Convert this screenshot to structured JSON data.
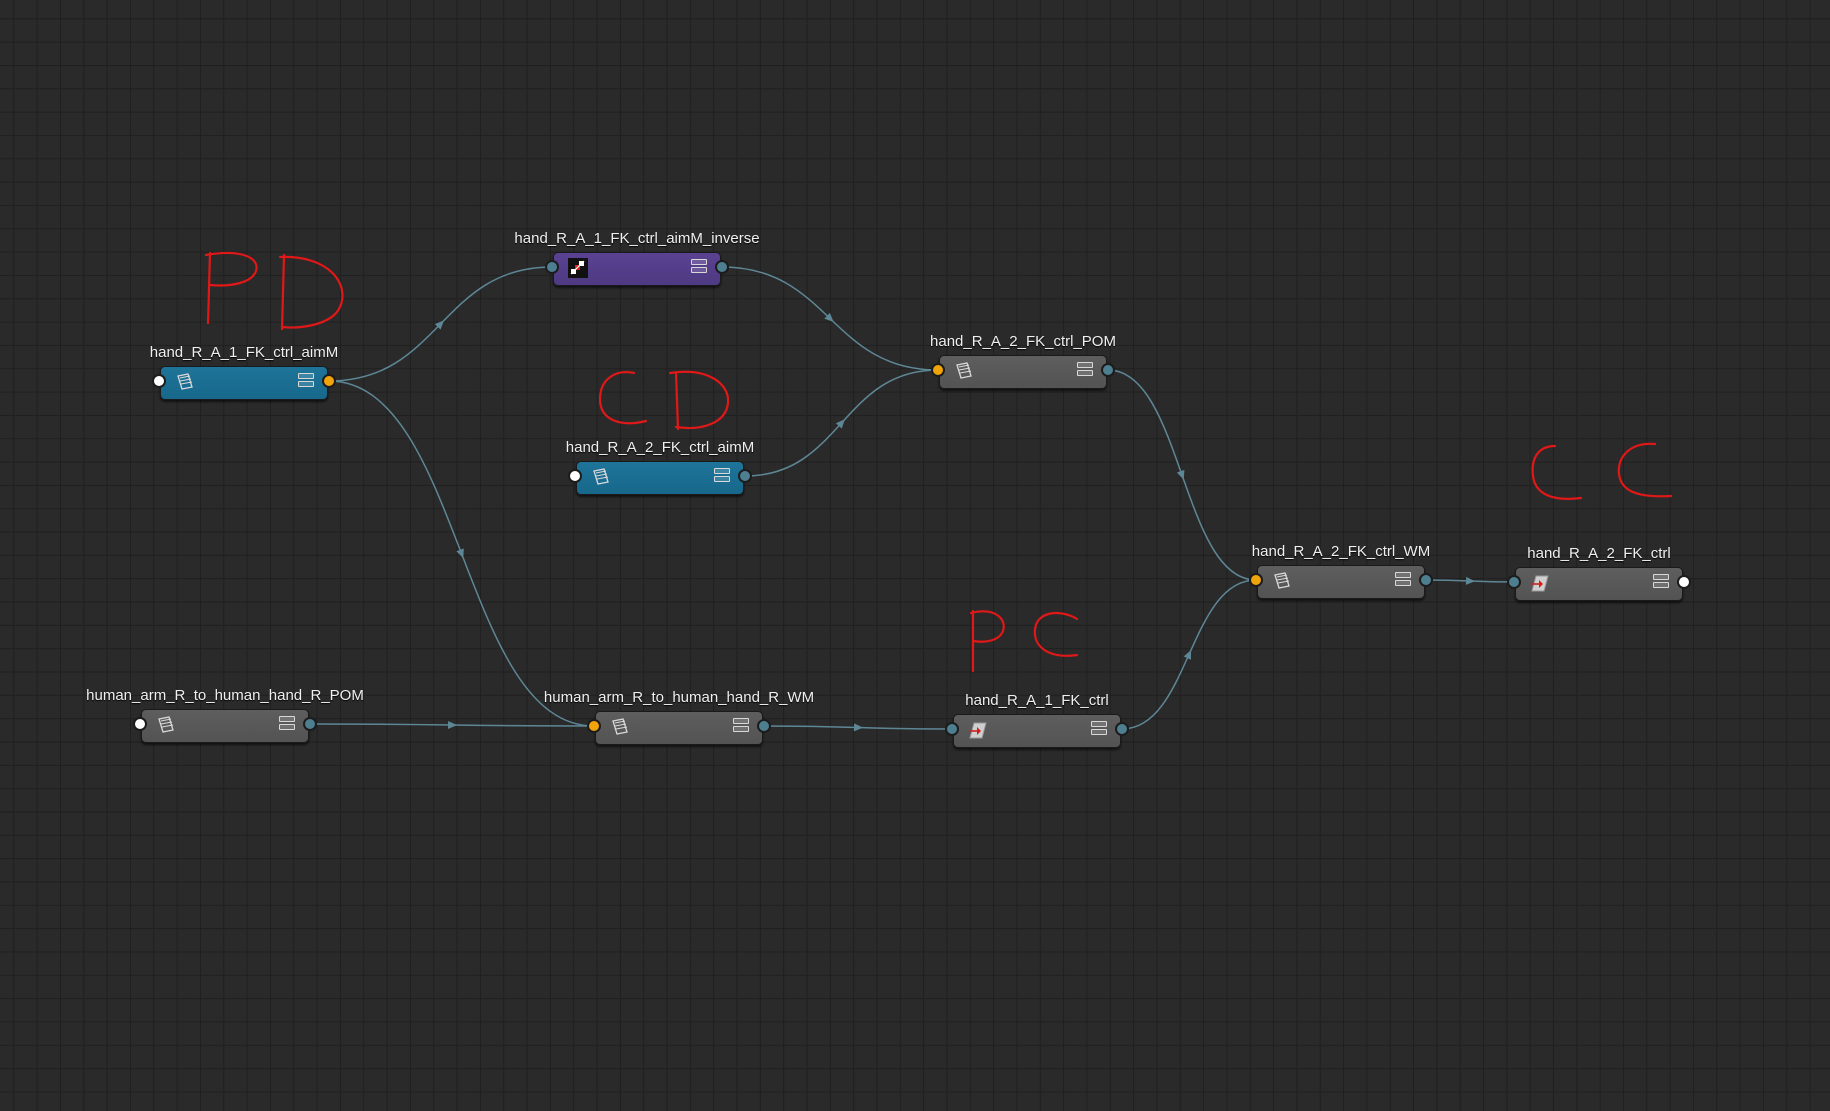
{
  "nodes": [
    {
      "key": "n_aimM1",
      "title": "hand_R_A_1_FK_ctrl_aimM",
      "color": "blue",
      "icon": "matrix-stack-icon",
      "in_port": "white",
      "out_port": "orange"
    },
    {
      "key": "n_aimM1_inv",
      "title": "hand_R_A_1_FK_ctrl_aimM_inverse",
      "color": "purple",
      "icon": "inverse-matrix-icon",
      "in_port": "teal",
      "out_port": "teal"
    },
    {
      "key": "n_aimM2",
      "title": "hand_R_A_2_FK_ctrl_aimM",
      "color": "blue",
      "icon": "matrix-stack-icon",
      "in_port": "white",
      "out_port": "teal"
    },
    {
      "key": "n_pom2",
      "title": "hand_R_A_2_FK_ctrl_POM",
      "color": "gray",
      "icon": "matrix-stack-icon",
      "in_port": "orange",
      "out_port": "teal"
    },
    {
      "key": "n_wm2",
      "title": "hand_R_A_2_FK_ctrl_WM",
      "color": "gray",
      "icon": "matrix-stack-icon",
      "in_port": "orange",
      "out_port": "teal"
    },
    {
      "key": "n_ctrl2",
      "title": "hand_R_A_2_FK_ctrl",
      "color": "gray",
      "icon": "transform-icon",
      "in_port": "teal",
      "out_port": "white"
    },
    {
      "key": "n_arm_pom",
      "title": "human_arm_R_to_human_hand_R_POM",
      "color": "gray",
      "icon": "matrix-stack-icon",
      "in_port": "white",
      "out_port": "teal"
    },
    {
      "key": "n_arm_wm",
      "title": "human_arm_R_to_human_hand_R_WM",
      "color": "gray",
      "icon": "matrix-stack-icon",
      "in_port": "orange",
      "out_port": "teal"
    },
    {
      "key": "n_ctrl1",
      "title": "hand_R_A_1_FK_ctrl",
      "color": "gray",
      "icon": "transform-icon",
      "in_port": "teal",
      "out_port": "teal"
    }
  ],
  "connections": [
    {
      "from": "n_aimM1",
      "to": "n_aimM1_inv"
    },
    {
      "from": "n_aimM1",
      "to": "n_arm_wm"
    },
    {
      "from": "n_aimM1_inv",
      "to": "n_pom2"
    },
    {
      "from": "n_aimM2",
      "to": "n_pom2"
    },
    {
      "from": "n_pom2",
      "to": "n_wm2"
    },
    {
      "from": "n_arm_pom",
      "to": "n_arm_wm"
    },
    {
      "from": "n_arm_wm",
      "to": "n_ctrl1"
    },
    {
      "from": "n_ctrl1",
      "to": "n_wm2"
    },
    {
      "from": "n_wm2",
      "to": "n_ctrl2"
    }
  ],
  "annotations": [
    {
      "key": "a_pd",
      "text": "PD",
      "color": "#e01818"
    },
    {
      "key": "a_cd",
      "text": "CD",
      "color": "#e01818"
    },
    {
      "key": "a_pc",
      "text": "PC",
      "color": "#e01818"
    },
    {
      "key": "a_cc",
      "text": "CC",
      "color": "#e01818"
    }
  ],
  "colors": {
    "wire": "#5e8796",
    "port_orange": "#f0a30a",
    "port_teal": "#4d7f91",
    "port_white": "#ffffff"
  }
}
